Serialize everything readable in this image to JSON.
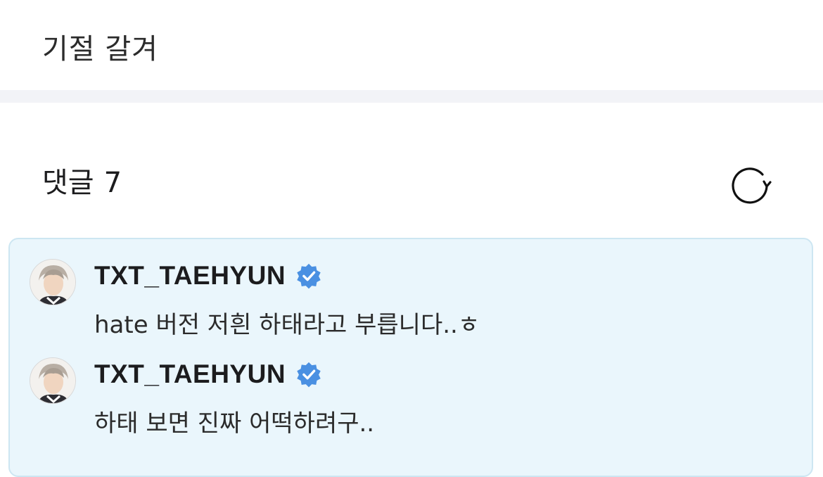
{
  "post": {
    "text": "기절 갈겨"
  },
  "comments_section": {
    "title": "댓글",
    "count": "7",
    "refresh_icon": "refresh-icon"
  },
  "comments": [
    {
      "author": "TXT_TAEHYUN",
      "verified": true,
      "text": "hate 버전 저흰 하태라고 부릅니다..ㅎ"
    },
    {
      "author": "TXT_TAEHYUN",
      "verified": true,
      "text": "하태 보면 진짜 어떡하려구.."
    }
  ],
  "colors": {
    "divider": "#f2f3f7",
    "highlight_background": "#eaf6fc",
    "highlight_border": "#cde6f2",
    "verified_badge": "#4a90e2"
  }
}
